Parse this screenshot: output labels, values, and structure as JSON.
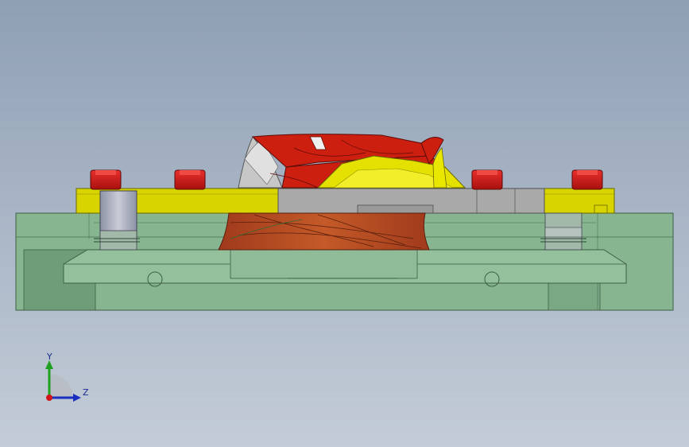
{
  "viewport": {
    "background_top": "#8f9fb4",
    "background_bottom": "#c3ccd7"
  },
  "model": {
    "colors": {
      "base_plate": "#86b590",
      "base_edge": "#3d5e45",
      "yellow_plate": "#d8d400",
      "red_impeller": "#cc1f10",
      "red_cap": "#d2141c",
      "gray_plate": "#a9a9a9",
      "steel_post": "#b8bcc8"
    }
  },
  "triad": {
    "y_label": "Y",
    "z_label": "Z",
    "icons": [
      "y-axis-arrow-icon",
      "z-axis-arrow-icon",
      "origin-icon"
    ]
  }
}
